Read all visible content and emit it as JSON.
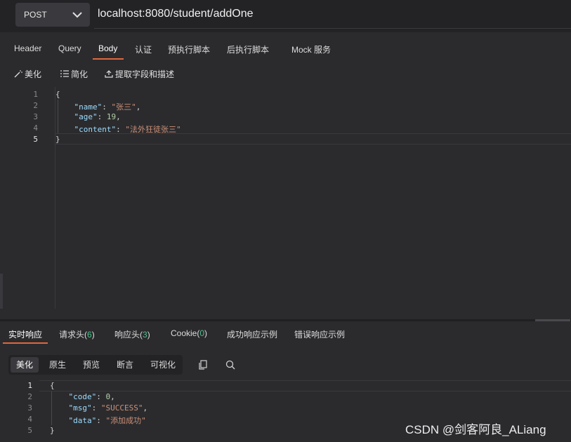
{
  "request": {
    "method": "POST",
    "url": "localhost:8080/student/addOne"
  },
  "tabs": [
    {
      "label": "Header"
    },
    {
      "label": "Query"
    },
    {
      "label": "Body",
      "active": true
    },
    {
      "label": "认证"
    },
    {
      "label": "预执行脚本"
    },
    {
      "label": "后执行脚本"
    },
    {
      "label": "Mock 服务"
    }
  ],
  "toolbar": {
    "beautify": "美化",
    "simplify": "简化",
    "extract": "提取字段和描述"
  },
  "body_editor": {
    "line_numbers": [
      "1",
      "2",
      "3",
      "4",
      "5"
    ],
    "open_brace": "{",
    "close_brace": "}",
    "fields": [
      {
        "key": "\"name\"",
        "colon": ": ",
        "value": "\"张三\"",
        "value_type": "string",
        "tail": ","
      },
      {
        "key": "\"age\"",
        "colon": ": ",
        "value": "19",
        "value_type": "number",
        "tail": ","
      },
      {
        "key": "\"content\"",
        "colon": ": ",
        "value": "\"法外狂徒张三\"",
        "value_type": "string",
        "tail": ""
      }
    ]
  },
  "response_tabs": {
    "realtime": "实时响应",
    "req_headers": "请求头(",
    "req_headers_count": "6",
    "resp_headers": "响应头(",
    "resp_headers_count": "3",
    "cookie": "Cookie(",
    "cookie_count": "0",
    "close_paren": ")",
    "success_example": "成功响应示例",
    "error_example": "错误响应示例"
  },
  "view_modes": [
    "美化",
    "原生",
    "预览",
    "断言",
    "可视化"
  ],
  "icons": {
    "copy": "copy-icon",
    "search": "search-icon"
  },
  "response_editor": {
    "line_numbers": [
      "1",
      "2",
      "3",
      "4",
      "5"
    ],
    "open_brace": "{",
    "close_brace": "}",
    "fields": [
      {
        "key": "\"code\"",
        "colon": ": ",
        "value": "0",
        "value_type": "number",
        "tail": ","
      },
      {
        "key": "\"msg\"",
        "colon": ": ",
        "value": "\"SUCCESS\"",
        "value_type": "string",
        "tail": ","
      },
      {
        "key": "\"data\"",
        "colon": ": ",
        "value": "\"添加成功\"",
        "value_type": "string",
        "tail": ""
      }
    ]
  },
  "watermark": "CSDN @剑客阿良_ALiang",
  "colors": {
    "accent": "#e0683c",
    "count": "#4fbf8a",
    "json_key": "#9cdcfe",
    "json_string": "#ce9178",
    "json_number": "#b5cea8"
  }
}
